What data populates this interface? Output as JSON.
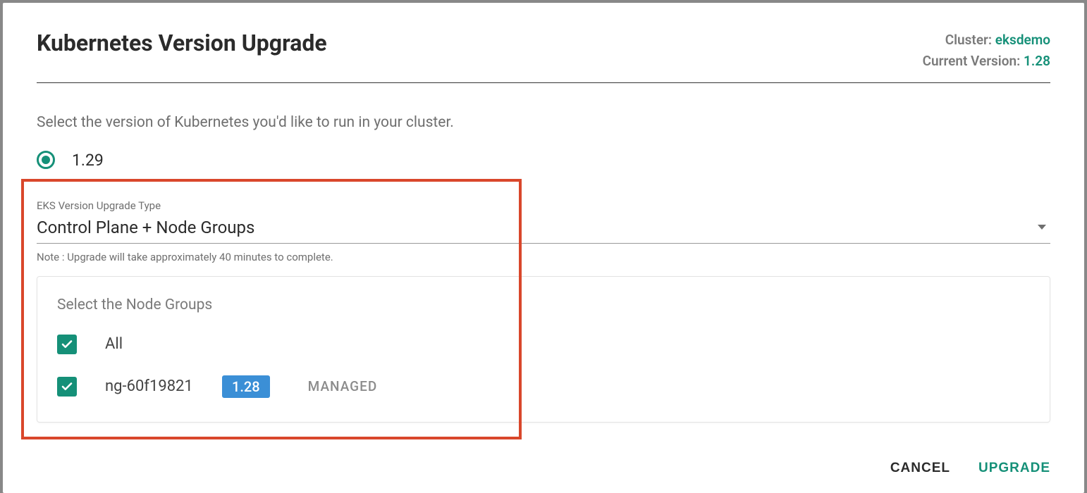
{
  "header": {
    "title": "Kubernetes Version Upgrade",
    "cluster_label": "Cluster:",
    "cluster_name": "eksdemo",
    "current_version_label": "Current Version:",
    "current_version": "1.28"
  },
  "instruction": "Select the version of Kubernetes you'd like to run in your cluster.",
  "version_option": "1.29",
  "upgrade_type": {
    "label": "EKS Version Upgrade Type",
    "value": "Control Plane + Node Groups",
    "note": "Note : Upgrade will take approximately 40 minutes to complete."
  },
  "node_groups": {
    "title": "Select the Node Groups",
    "all_label": "All",
    "items": [
      {
        "name": "ng-60f19821",
        "version": "1.28",
        "type": "MANAGED"
      }
    ]
  },
  "footer": {
    "cancel": "CANCEL",
    "upgrade": "UPGRADE"
  },
  "colors": {
    "accent": "#159078",
    "highlight": "#d9472b",
    "badge": "#3b8fd6"
  }
}
